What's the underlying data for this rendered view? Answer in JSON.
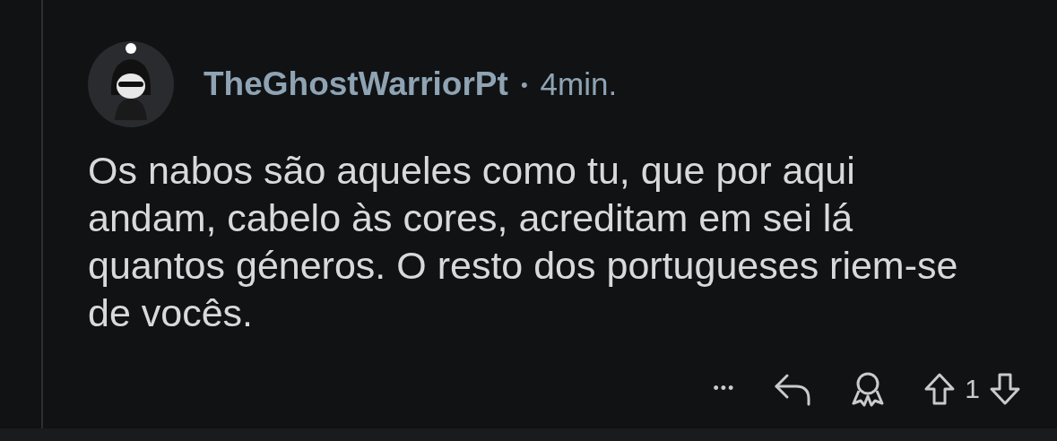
{
  "comment": {
    "author": "TheGhostWarriorPt",
    "separator": "•",
    "time": "4min.",
    "body": "Os nabos são aqueles como tu, que por aqui andam, cabelo às cores, acreditam em sei lá quantos géneros. O resto dos portugueses riem-se de vocês.",
    "more": "•••",
    "score": "1"
  }
}
